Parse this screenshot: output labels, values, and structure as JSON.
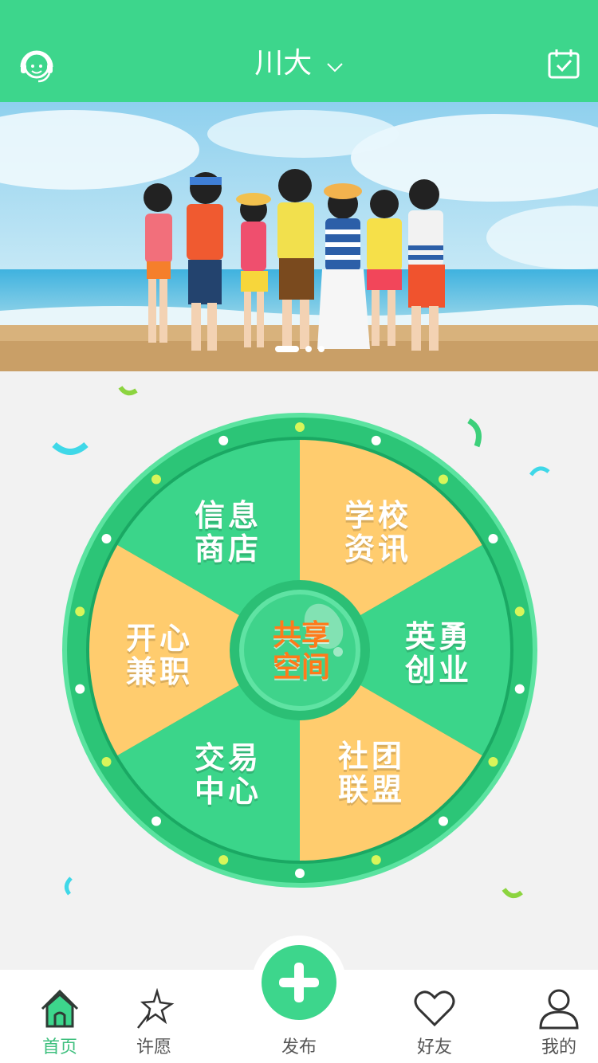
{
  "header": {
    "title": "川大",
    "left_icon": "customer-service-icon",
    "right_icon": "calendar-check-icon",
    "accent": "#3dd68c"
  },
  "banner": {
    "image": "group of friends on beach illustration",
    "page_indicator": {
      "count": 3,
      "active": 1
    }
  },
  "wheel": {
    "center": {
      "line1": "共享",
      "line2": "空间"
    },
    "segments": [
      {
        "line1": "学校",
        "line2": "资讯",
        "color": "#ffcc6e"
      },
      {
        "line1": "英勇",
        "line2": "创业",
        "color": "#3bd58a"
      },
      {
        "line1": "社团",
        "line2": "联盟",
        "color": "#ffcc6e"
      },
      {
        "line1": "交易",
        "line2": "中心",
        "color": "#3bd58a"
      },
      {
        "line1": "开心",
        "line2": "兼职",
        "color": "#ffcc6e"
      },
      {
        "line1": "信息",
        "line2": "商店",
        "color": "#3bd58a"
      }
    ]
  },
  "tabbar": {
    "items": [
      {
        "label": "首页",
        "icon": "home-icon",
        "active": true
      },
      {
        "label": "许愿",
        "icon": "wish-star-icon",
        "active": false
      },
      {
        "label": "发布",
        "icon": "plus-icon",
        "active": false
      },
      {
        "label": "好友",
        "icon": "heart-icon",
        "active": false
      },
      {
        "label": "我的",
        "icon": "user-icon",
        "active": false
      }
    ]
  }
}
